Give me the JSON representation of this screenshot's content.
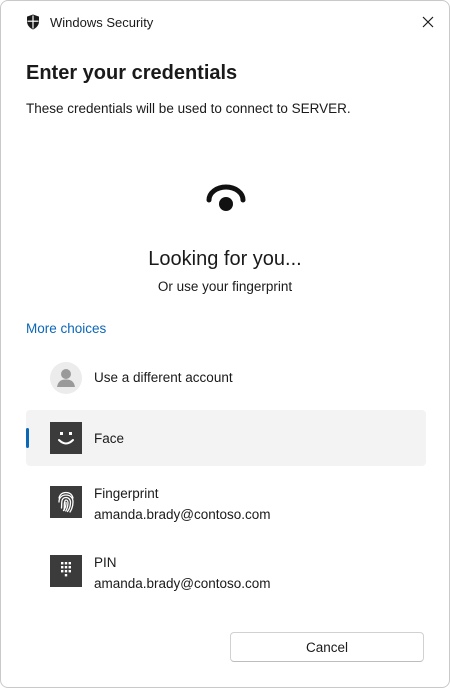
{
  "window": {
    "title": "Windows Security",
    "title_icon": "shield-icon",
    "close_icon": "close-icon"
  },
  "dialog": {
    "heading": "Enter your credentials",
    "subtext": "These credentials will be used to connect to SERVER."
  },
  "status": {
    "icon": "face-recognition-icon",
    "main": "Looking for you...",
    "sub": "Or use your fingerprint"
  },
  "more_choices": {
    "label": "More choices"
  },
  "options": [
    {
      "icon": "user-avatar-icon",
      "label": "Use a different account",
      "selected": false
    },
    {
      "icon": "face-icon",
      "label": "Face",
      "selected": true
    },
    {
      "icon": "fingerprint-icon",
      "label": "Fingerprint",
      "account": "amanda.brady@contoso.com",
      "selected": false
    },
    {
      "icon": "pin-keypad-icon",
      "label": "PIN",
      "account": "amanda.brady@contoso.com",
      "selected": false
    }
  ],
  "buttons": {
    "cancel": "Cancel"
  },
  "colors": {
    "accent": "#0b67b8",
    "selected_background": "#f3f3f3",
    "icon_tile": "#3b3b3b"
  }
}
